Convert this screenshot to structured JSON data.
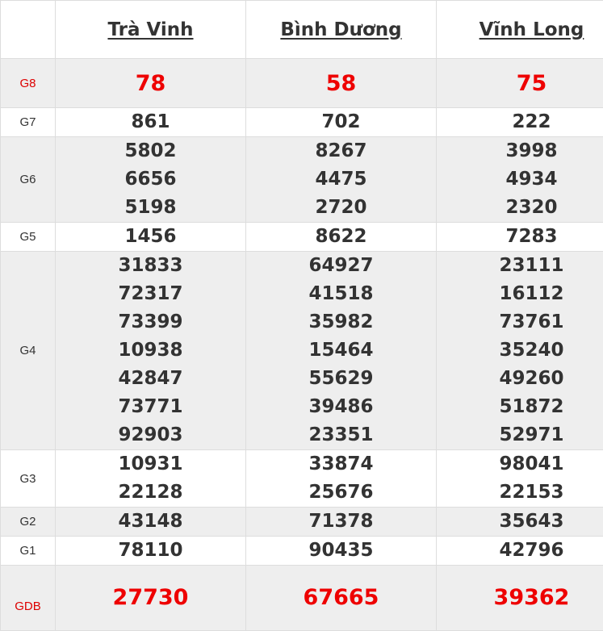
{
  "provinces": [
    "Trà Vinh",
    "Bình Dương",
    "Vĩnh Long"
  ],
  "prizes": [
    {
      "label": "G8",
      "numbers": [
        [
          "78"
        ],
        [
          "58"
        ],
        [
          "75"
        ]
      ]
    },
    {
      "label": "G7",
      "numbers": [
        [
          "861"
        ],
        [
          "702"
        ],
        [
          "222"
        ]
      ]
    },
    {
      "label": "G6",
      "numbers": [
        [
          "5802",
          "6656",
          "5198"
        ],
        [
          "8267",
          "4475",
          "2720"
        ],
        [
          "3998",
          "4934",
          "2320"
        ]
      ]
    },
    {
      "label": "G5",
      "numbers": [
        [
          "1456"
        ],
        [
          "8622"
        ],
        [
          "7283"
        ]
      ]
    },
    {
      "label": "G4",
      "numbers": [
        [
          "31833",
          "72317",
          "73399",
          "10938",
          "42847",
          "73771",
          "92903"
        ],
        [
          "64927",
          "41518",
          "35982",
          "15464",
          "55629",
          "39486",
          "23351"
        ],
        [
          "23111",
          "16112",
          "73761",
          "35240",
          "49260",
          "51872",
          "52971"
        ]
      ]
    },
    {
      "label": "G3",
      "numbers": [
        [
          "10931",
          "22128"
        ],
        [
          "33874",
          "25676"
        ],
        [
          "98041",
          "22153"
        ]
      ]
    },
    {
      "label": "G2",
      "numbers": [
        [
          "43148"
        ],
        [
          "71378"
        ],
        [
          "35643"
        ]
      ]
    },
    {
      "label": "G1",
      "numbers": [
        [
          "78110"
        ],
        [
          "90435"
        ],
        [
          "42796"
        ]
      ]
    },
    {
      "label": "GDB",
      "numbers": [
        [
          "27730"
        ],
        [
          "67665"
        ],
        [
          "39362"
        ]
      ]
    }
  ],
  "colors": {
    "highlight": "#ee0000",
    "text": "#333333",
    "shade": "#eeeeee"
  }
}
